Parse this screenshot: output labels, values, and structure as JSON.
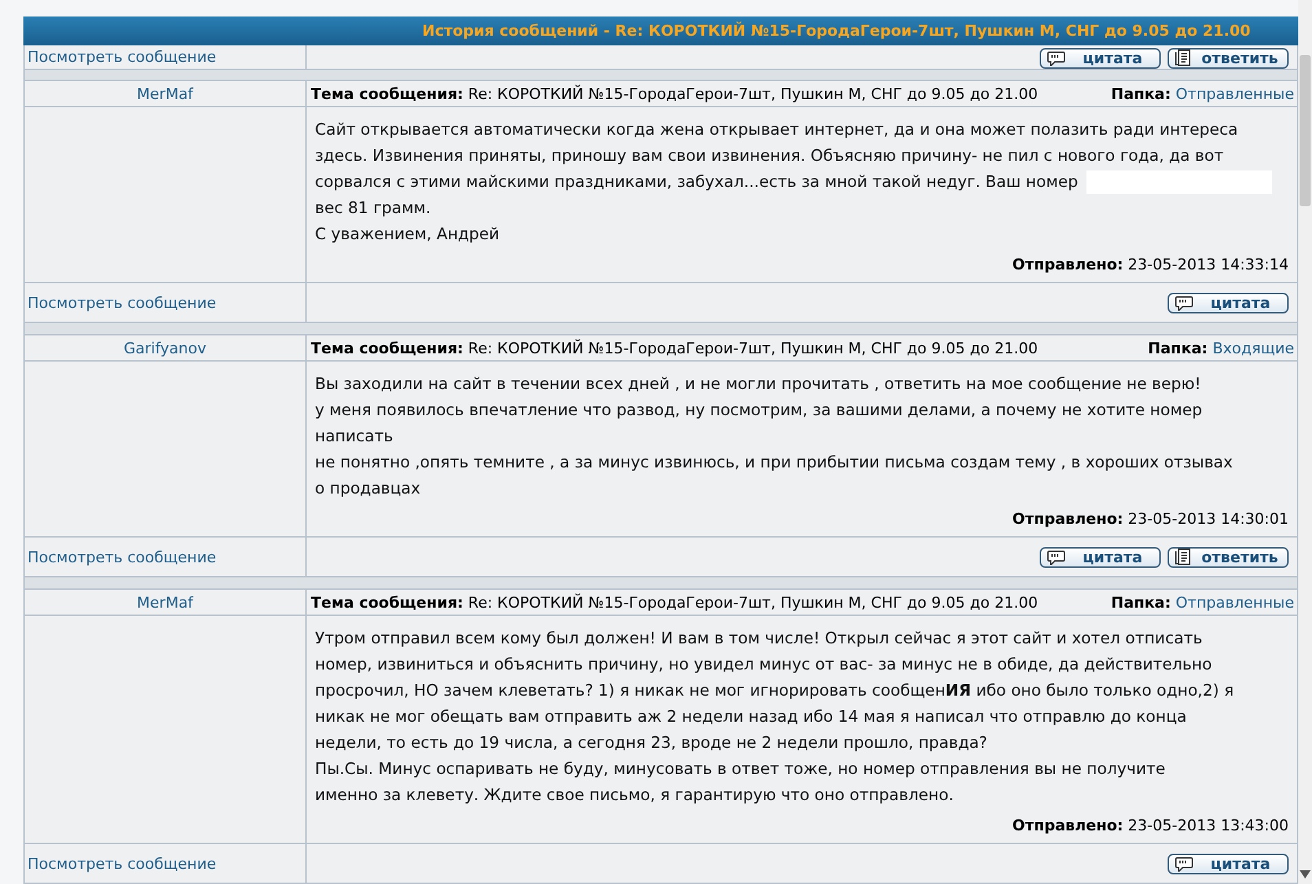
{
  "window": {
    "title": "История сообщений - Re: КОРОТКИЙ №15-ГородаГерои-7шт, Пушкин М, СНГ до 9.05 до 21.00"
  },
  "top_row": {
    "view_link": "Посмотреть сообщение",
    "buttons": [
      {
        "kind": "quote",
        "label": "цитата"
      },
      {
        "kind": "reply",
        "label": "ответить"
      }
    ]
  },
  "posts": [
    {
      "author": "MerMaf",
      "subject_label": "Тема сообщения:",
      "subject": "Re: КОРОТКИЙ №15-ГородаГерои-7шт, Пушкин М, СНГ до 9.05 до 21.00",
      "folder_label": "Папка:",
      "folder": "Отправленные",
      "lines": [
        {
          "text": "Сайт открывается автоматически когда жена открывает интернет, да и она может полазить ради интереса"
        },
        {
          "text": "здесь. Извинения приняты, приношу вам свои извинения. Объясняю причину- не пил с нового года, да вот"
        },
        {
          "text": "сорвался с этими майскими праздниками, забухал...есть за мной такой недуг. Ваш номер",
          "redacted": true
        },
        {
          "text": "вес 81 грамм."
        },
        {
          "text": "С уважением, Андрей"
        }
      ],
      "sent_label": "Отправлено:",
      "sent": "23-05-2013 14:33:14",
      "view_link": "Посмотреть сообщение",
      "buttons": [
        {
          "kind": "quote",
          "label": "цитата"
        }
      ]
    },
    {
      "author": "Garifyanov",
      "subject_label": "Тема сообщения:",
      "subject": "Re: КОРОТКИЙ №15-ГородаГерои-7шт, Пушкин М, СНГ до 9.05 до 21.00",
      "folder_label": "Папка:",
      "folder": "Входящие",
      "lines": [
        {
          "text": "Вы заходили на сайт в течении всех дней , и не могли прочитать , ответить на мое сообщение не верю!"
        },
        {
          "text": "у меня появилось впечатление что развод, ну посмотрим, за вашими делами, а почему не хотите номер"
        },
        {
          "text": "написать"
        },
        {
          "text": "не понятно ,опять темните , а за минус извинюсь, и при прибытии письма создам тему , в хороших отзывах"
        },
        {
          "text": "о продавцах"
        }
      ],
      "sent_label": "Отправлено:",
      "sent": "23-05-2013 14:30:01",
      "view_link": "Посмотреть сообщение",
      "buttons": [
        {
          "kind": "quote",
          "label": "цитата"
        },
        {
          "kind": "reply",
          "label": "ответить"
        }
      ]
    },
    {
      "author": "MerMaf",
      "subject_label": "Тема сообщения:",
      "subject": "Re: КОРОТКИЙ №15-ГородаГерои-7шт, Пушкин М, СНГ до 9.05 до 21.00",
      "folder_label": "Папка:",
      "folder": "Отправленные",
      "lines": [
        {
          "text": "Утром отправил всем кому был должен! И вам в том числе! Открыл сейчас я этот сайт и хотел отписать"
        },
        {
          "text": "номер, извиниться и объяснить причину, но увидел минус от вас- за минус не в обиде, да действительно"
        },
        {
          "text": "просрочил, НО зачем клеветать? 1) я никак не мог игнорировать сообщен**ИЯ** ибо оно было только одно,2) я"
        },
        {
          "text": "никак не мог обещать вам отправить аж 2 недели назад ибо 14 мая я написал что отправлю до конца"
        },
        {
          "text": "недели, то есть до 19 числа, а сегодня 23, вроде не 2 недели прошло, правда?"
        },
        {
          "text": "Пы.Сы. Минус оспаривать не буду, минусовать в ответ тоже, но номер отправления вы не получите"
        },
        {
          "text": "именно за клевету. Ждите свое письмо, я гарантирую что оно отправлено."
        }
      ],
      "sent_label": "Отправлено:",
      "sent": "23-05-2013 13:43:00",
      "view_link": "Посмотреть сообщение",
      "buttons": [
        {
          "kind": "quote",
          "label": "цитата"
        }
      ]
    }
  ]
}
